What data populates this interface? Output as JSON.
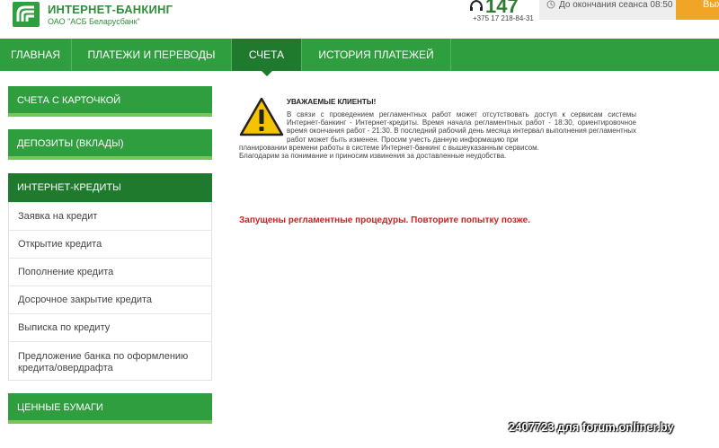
{
  "header": {
    "logo_title": "ИНТЕРНЕТ-БАНКИНГ",
    "logo_subtitle": "ОАО \"АСБ Беларусбанк\"",
    "phone_short": "147",
    "phone_full": "+375 17 218-84-31",
    "session_text": "До окончания сеанса 08:50",
    "exit_label": "Вых",
    "brand_color": "#2f9e3f",
    "accent_color": "#f0a526"
  },
  "topnav": {
    "items": [
      {
        "label": "ГЛАВНАЯ"
      },
      {
        "label": "ПЛАТЕЖИ И ПЕРЕВОДЫ"
      },
      {
        "label": "СЧЕТА"
      },
      {
        "label": "ИСТОРИЯ ПЛАТЕЖЕЙ"
      }
    ],
    "active_index": 2
  },
  "sidebar": {
    "blocks": [
      {
        "label": "СЧЕТА С КАРТОЧКОЙ"
      },
      {
        "label": "ДЕПОЗИТЫ (ВКЛАДЫ)"
      },
      {
        "label": "ИНТЕРНЕТ-КРЕДИТЫ"
      },
      {
        "label": "ЦЕННЫЕ БУМАГИ"
      }
    ],
    "credit_items": [
      {
        "label": "Заявка на кредит"
      },
      {
        "label": "Открытие кредита"
      },
      {
        "label": "Пополнение кредита"
      },
      {
        "label": "Досрочное закрытие кредита"
      },
      {
        "label": "Выписка по кредиту"
      },
      {
        "label": "Предложение банка по оформлению кредита/овердрафта"
      }
    ]
  },
  "notice": {
    "title": "УВАЖАЕМЫЕ КЛИЕНТЫ!",
    "body_indented": "В связи с проведением регламентных работ может отсутствовать доступ к сервисам системы Интернет-банкинг - Интернет-кредиты. Время начала регламентных работ - 18:30, ориентировочное время окончания работ - 21:30. В последний рабочий день месяца интервал выполнения регламентных работ может быть изменен. Просим учесть данную информацию при",
    "body_full": "планировании времени работы в системе Интернет-банкинг с вышеуказанным сервисом.",
    "closing": "Благодарим за понимание и приносим извинения за доставленные неудобства.",
    "icon": "warning-icon"
  },
  "error_message": "Запущены регламентные процедуры. Повторите попытку позже.",
  "watermark": "2407723 для forum.onliner.by"
}
